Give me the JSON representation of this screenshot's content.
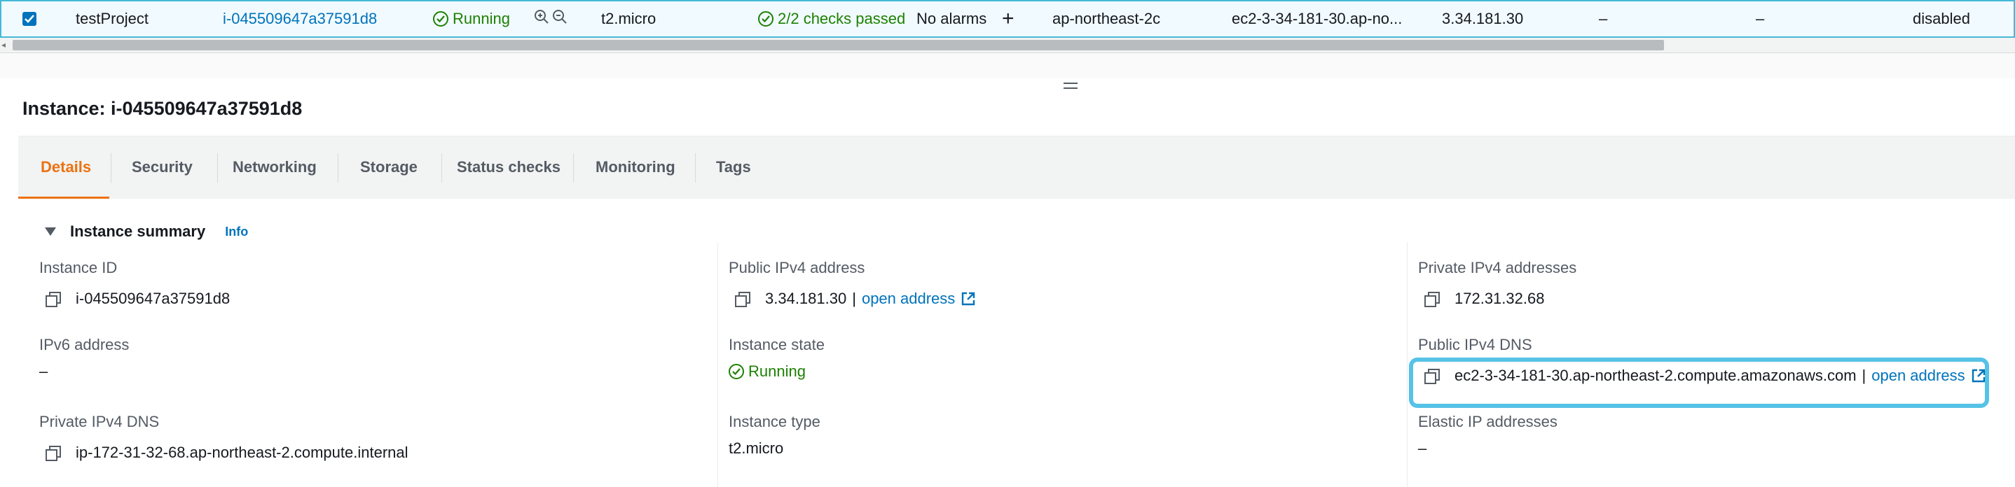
{
  "row": {
    "name": "testProject",
    "instance_id": "i-045509647a37591d8",
    "state": "Running",
    "instance_type": "t2.micro",
    "status_check": "2/2 checks passed",
    "alarm_status": "No alarms",
    "alarm_add": "+",
    "availability_zone": "ap-northeast-2c",
    "public_dns": "ec2-3-34-181-30.ap-no...",
    "public_ip": "3.34.181.30",
    "elastic_ip": "–",
    "ipv6": "–",
    "monitoring": "disabled"
  },
  "scrollbar": {
    "thumb_fraction": 0.83
  },
  "panel": {
    "title": "Instance: i-045509647a37591d8",
    "tabs": [
      {
        "label": "Details"
      },
      {
        "label": "Security"
      },
      {
        "label": "Networking"
      },
      {
        "label": "Storage"
      },
      {
        "label": "Status checks"
      },
      {
        "label": "Monitoring"
      },
      {
        "label": "Tags"
      }
    ],
    "active_tab": "Details"
  },
  "summary": {
    "title": "Instance summary",
    "info": "Info",
    "fields": {
      "instance_id": {
        "label": "Instance ID",
        "value": "i-045509647a37591d8"
      },
      "ipv6": {
        "label": "IPv6 address",
        "value": "–"
      },
      "private_dns": {
        "label": "Private IPv4 DNS",
        "value": "ip-172-31-32-68.ap-northeast-2.compute.internal"
      },
      "public_ipv4": {
        "label": "Public IPv4 address",
        "value": "3.34.181.30",
        "link": "open address"
      },
      "state": {
        "label": "Instance state",
        "value": "Running"
      },
      "type": {
        "label": "Instance type",
        "value": "t2.micro"
      },
      "private_ipv4": {
        "label": "Private IPv4 addresses",
        "value": "172.31.32.68"
      },
      "public_dns": {
        "label": "Public IPv4 DNS",
        "value": "ec2-3-34-181-30.ap-northeast-2.compute.amazonaws.com",
        "link": "open address"
      },
      "elastic_ip": {
        "label": "Elastic IP addresses",
        "value": "–"
      }
    }
  },
  "colors": {
    "accent_tab": "#ec7211",
    "link": "#0073bb",
    "success": "#1d8102",
    "selected_row_bg": "#f1faff",
    "highlight_box": "#56c2e6"
  },
  "icons": [
    "checkbox-checked-icon",
    "status-ok-icon",
    "zoom-in-icon",
    "zoom-out-icon",
    "copy-icon",
    "external-link-icon",
    "caret-down-icon",
    "resize-handle-icon"
  ]
}
